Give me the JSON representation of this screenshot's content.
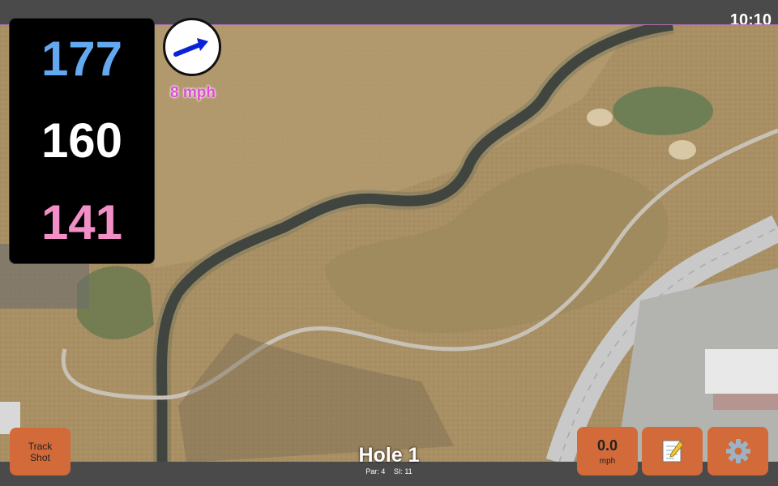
{
  "status": {
    "time": "10:10"
  },
  "distances": {
    "back": "177",
    "middle": "160",
    "front": "141"
  },
  "wind": {
    "speed_label": "8 mph",
    "arrow_icon": "wind-direction-arrow-icon"
  },
  "hole": {
    "title": "Hole 1",
    "par_label": "Par: 4",
    "si_label": "SI: 11"
  },
  "buttons": {
    "track_shot_line1": "Track",
    "track_shot_line2": "Shot",
    "wind_value": "0.0",
    "wind_unit": "mph",
    "notes_icon": "notepad-icon",
    "settings_icon": "gear-icon"
  },
  "colors": {
    "back_distance": "#64a8f0",
    "middle_distance": "#ffffff",
    "front_distance": "#f28fc6",
    "wind_text": "#e04bd8",
    "button_bg": "#d26a3a"
  }
}
